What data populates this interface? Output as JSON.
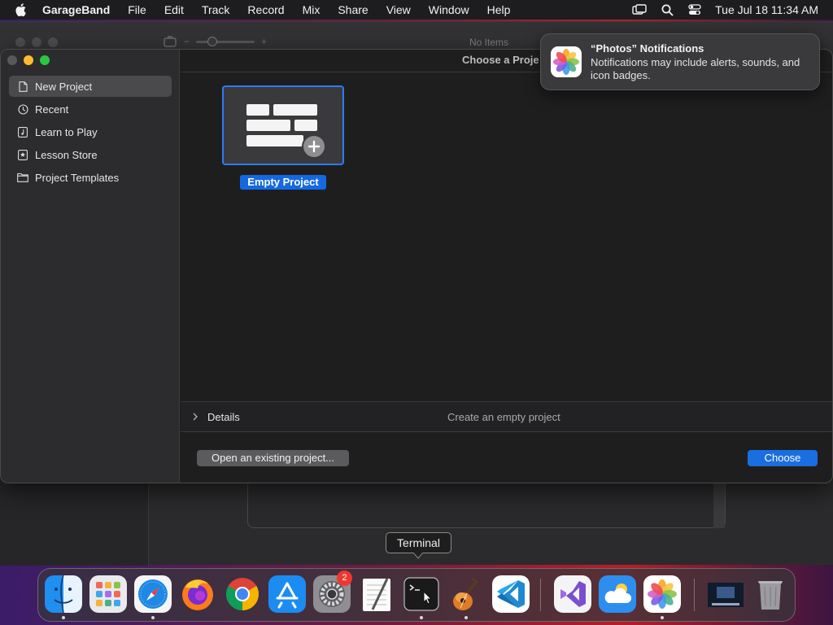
{
  "menubar": {
    "app_name": "GarageBand",
    "items": [
      "File",
      "Edit",
      "Track",
      "Record",
      "Mix",
      "Share",
      "View",
      "Window",
      "Help"
    ],
    "clock": "Tue Jul 18  11:34 AM",
    "status_icons": [
      "screen-mirroring-icon",
      "search-icon",
      "control-center-icon"
    ]
  },
  "background_window": {
    "status": "No Items"
  },
  "sheet": {
    "title": "Choose a Proje",
    "sidebar": [
      {
        "label": "New Project",
        "icon": "document-icon",
        "selected": true
      },
      {
        "label": "Recent",
        "icon": "clock-icon",
        "selected": false
      },
      {
        "label": "Learn to Play",
        "icon": "music-note-icon",
        "selected": false
      },
      {
        "label": "Lesson Store",
        "icon": "star-icon",
        "selected": false
      },
      {
        "label": "Project Templates",
        "icon": "folder-icon",
        "selected": false
      }
    ],
    "template_label": "Empty Project",
    "details_label": "Details",
    "details_description": "Create an empty project",
    "open_button": "Open an existing project...",
    "choose_button": "Choose",
    "accent_color": "#1a6ee0"
  },
  "notification": {
    "title": "“Photos” Notifications",
    "body": "Notifications may include alerts, sounds, and icon badges."
  },
  "tooltip": "Terminal",
  "dock": {
    "apps": [
      "Finder",
      "Launchpad",
      "Safari",
      "Firefox",
      "Google Chrome",
      "App Store",
      "System Settings",
      "TextEdit",
      "Terminal",
      "GarageBand",
      "Visual Studio Code",
      "Visual Studio",
      "Weather",
      "Photos",
      "Desktop",
      "Trash"
    ],
    "settings_badge": "2"
  }
}
